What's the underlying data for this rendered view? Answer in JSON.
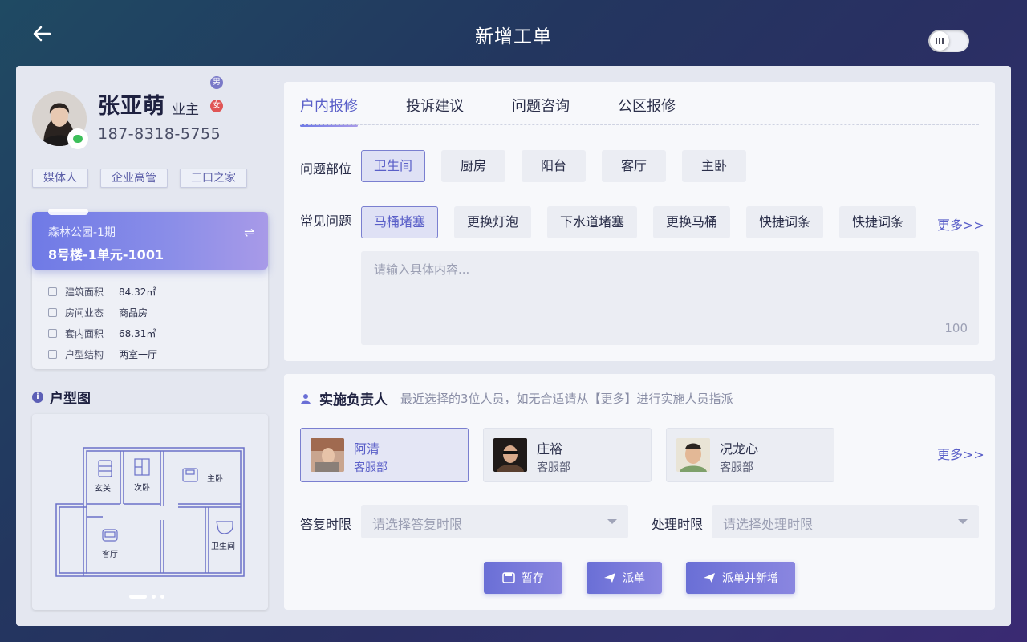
{
  "header": {
    "title": "新增工单"
  },
  "profile": {
    "name": "张亚萌",
    "role": "业主",
    "gender_male": "男",
    "gender_female": "女",
    "phone": "187-8318-5755",
    "tags": [
      "媒体人",
      "企业高管",
      "三口之家"
    ]
  },
  "house": {
    "community": "森林公园-1期",
    "unit": "8号楼-1单元-1001",
    "details": [
      {
        "label": "建筑面积",
        "value": "84.32㎡"
      },
      {
        "label": "房间业态",
        "value": "商品房"
      },
      {
        "label": "套内面积",
        "value": "68.31㎡"
      },
      {
        "label": "户型结构",
        "value": "两室一厅"
      }
    ]
  },
  "floorplan": {
    "title": "户型图",
    "rooms": [
      "玄关",
      "次卧",
      "主卧",
      "客厅",
      "卫生间"
    ]
  },
  "tabs": [
    "户内报修",
    "投诉建议",
    "问题咨询",
    "公区报修"
  ],
  "problem_area": {
    "label": "问题部位",
    "options": [
      "卫生间",
      "厨房",
      "阳台",
      "客厅",
      "主卧"
    ],
    "selected": "卫生间"
  },
  "common_issues": {
    "label": "常见问题",
    "options": [
      "马桶堵塞",
      "更换灯泡",
      "下水道堵塞",
      "更换马桶",
      "快捷词条",
      "快捷词条"
    ],
    "selected": "马桶堵塞",
    "more": "更多>>"
  },
  "description": {
    "placeholder": "请输入具体内容...",
    "max_count": "100"
  },
  "assignee": {
    "title": "实施负责人",
    "hint": "最近选择的3位人员，如无合适请从【更多】进行实施人员指派",
    "people": [
      {
        "name": "阿清",
        "dept": "客服部"
      },
      {
        "name": "庄裕",
        "dept": "客服部"
      },
      {
        "name": "况龙心",
        "dept": "客服部"
      }
    ],
    "more": "更多>>"
  },
  "reply_limit": {
    "label": "答复时限",
    "placeholder": "请选择答复时限"
  },
  "process_limit": {
    "label": "处理时限",
    "placeholder": "请选择处理时限"
  },
  "actions": {
    "save": "暂存",
    "dispatch": "派单",
    "dispatch_new": "派单并新增"
  },
  "colors": {
    "accent": "#5a5fc8",
    "panel": "#e4e7f0",
    "card": "#f7f8fb"
  }
}
